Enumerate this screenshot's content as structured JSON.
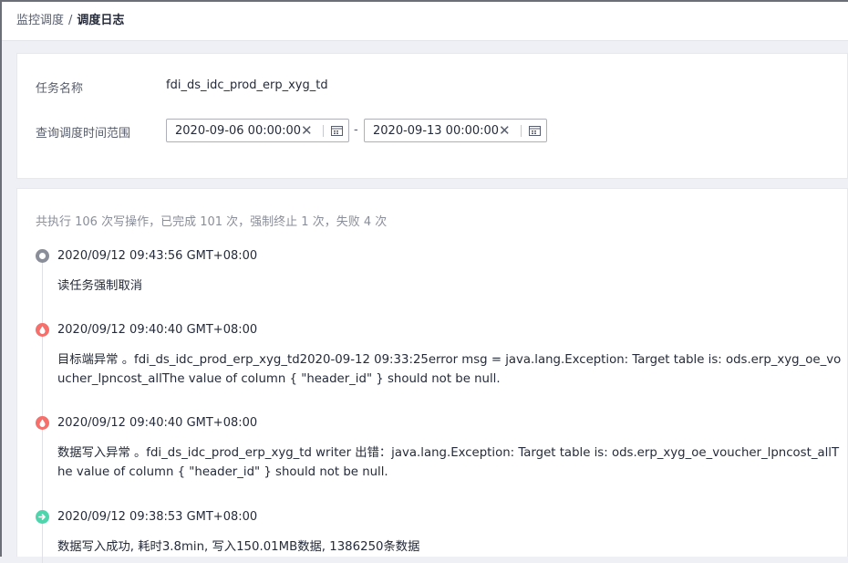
{
  "breadcrumb": {
    "parent": "监控调度",
    "separator": "/",
    "current": "调度日志"
  },
  "filter": {
    "task_name_label": "任务名称",
    "task_name_value": "fdi_ds_idc_prod_erp_xyg_td",
    "time_range_label": "查询调度时间范围",
    "start_date": "2020-09-06 00:00:00",
    "end_date": "2020-09-13 00:00:00",
    "range_separator": "-",
    "clear_icon_glyph": "✕"
  },
  "log": {
    "summary": "共执行 106 次写操作，已完成 101 次，强制终止 1 次，失败 4 次",
    "entries": [
      {
        "status": "cancelled",
        "icon": "cancel-dot-icon",
        "color": "#8a8e99",
        "time": "2020/09/12 09:43:56 GMT+08:00",
        "message": "读任务强制取消"
      },
      {
        "status": "error",
        "icon": "error-drop-icon",
        "color": "#f66f6a",
        "time": "2020/09/12 09:40:40 GMT+08:00",
        "message": "目标端异常 。fdi_ds_idc_prod_erp_xyg_td2020-09-12 09:33:25error msg = java.lang.Exception: Target table is: ods.erp_xyg_oe_voucher_lpncost_allThe value of column { \"header_id\" } should not be null."
      },
      {
        "status": "error",
        "icon": "error-drop-icon",
        "color": "#f66f6a",
        "time": "2020/09/12 09:40:40 GMT+08:00",
        "message": "数据写入异常 。fdi_ds_idc_prod_erp_xyg_td writer 出错：java.lang.Exception: Target table is: ods.erp_xyg_oe_voucher_lpncost_allThe value of column { \"header_id\" } should not be null."
      },
      {
        "status": "success",
        "icon": "success-arrow-icon",
        "color": "#50d4ab",
        "time": "2020/09/12 09:38:53 GMT+08:00",
        "message": "数据写入成功, 耗时3.8min, 写入150.01MB数据, 1386250条数据"
      }
    ]
  }
}
